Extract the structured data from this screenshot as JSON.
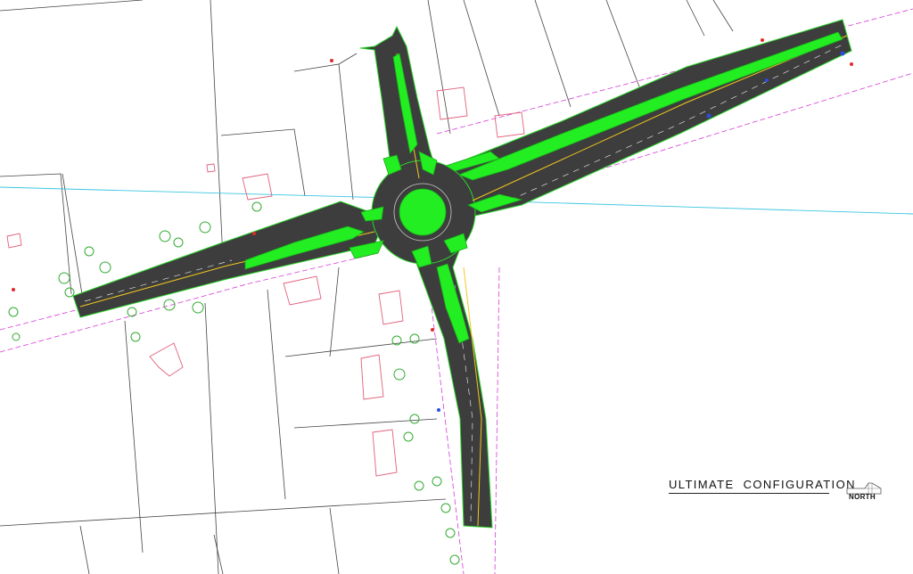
{
  "drawing": {
    "title": "ULTIMATE  CONFIGURATION",
    "north_label": "NORTH"
  },
  "colors": {
    "pavement": "#3d3d3d",
    "median": "#22ee22",
    "edge_line": "#2bd62b",
    "lane_marking": "#f2c81e",
    "property_line": "#444444",
    "building": "#e0607a",
    "right_of_way": "#d63cd6",
    "utility": "#3cc6e0",
    "tree": "#33aa33"
  },
  "icons": {
    "roundabout": "roundabout-icon",
    "north": "north-arrow-icon",
    "tree": "tree-icon"
  }
}
